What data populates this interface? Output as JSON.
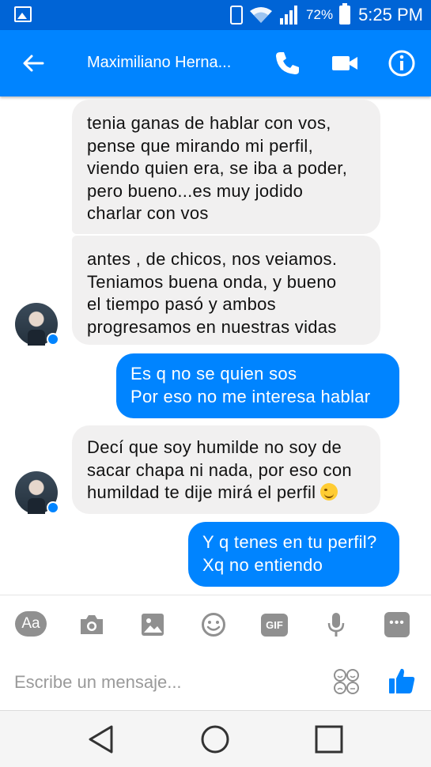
{
  "status_bar": {
    "battery_percent": "72%",
    "time": "5:25 PM",
    "icons": [
      "image-notification-icon",
      "vibrate-icon",
      "wifi-icon",
      "signal-icon",
      "battery-icon"
    ]
  },
  "header": {
    "title": "Maximiliano Herna...",
    "icons": [
      "back-arrow-icon",
      "phone-icon",
      "video-camera-icon",
      "info-icon"
    ]
  },
  "messages": [
    {
      "direction": "incoming",
      "lines": [
        "tenia ganas de hablar con vos,",
        "pense que mirando mi perfil,",
        "viendo quien era, se iba a poder,",
        "pero bueno...es muy jodido",
        "charlar con vos"
      ]
    },
    {
      "direction": "incoming",
      "lines": [
        "antes , de chicos, nos veiamos.",
        "Teniamos buena onda, y bueno",
        "el tiempo pasó y ambos",
        "progresamos en nuestras vidas"
      ]
    },
    {
      "direction": "outgoing",
      "lines": [
        "Es q no se quien sos",
        "Por eso no me interesa hablar"
      ]
    },
    {
      "direction": "incoming",
      "lines": [
        "Decí que soy humilde no soy de",
        "sacar chapa ni nada, por eso con",
        "humildad te dije mirá el perfil"
      ],
      "emoji": "wink-smile"
    },
    {
      "direction": "outgoing",
      "lines": [
        "Y q tenes en tu perfil?",
        "Xq no entiendo"
      ]
    }
  ],
  "composer": {
    "aa_label": "Aa",
    "gif_label": "GIF",
    "placeholder": "Escribe un mensaje...",
    "tools": [
      "text-style-icon",
      "camera-icon",
      "gallery-icon",
      "emoji-icon",
      "gif-icon",
      "microphone-icon",
      "more-icon"
    ]
  },
  "nav_bar": {
    "icons": [
      "nav-back-icon",
      "nav-home-icon",
      "nav-recents-icon"
    ]
  },
  "colors": {
    "status_bar": "#0064d6",
    "app_bar": "#0084ff",
    "incoming_bubble": "#f1f0f0",
    "outgoing_bubble": "#0084ff",
    "tool_icon": "#909090"
  }
}
